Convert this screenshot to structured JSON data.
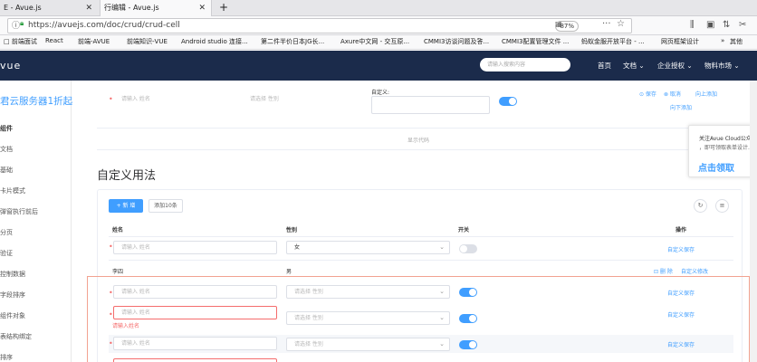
{
  "browser": {
    "tab1_title": "E - Avue.js",
    "tab2_title": "行编辑 - Avue.js",
    "url": "https://avuejs.com/doc/crud/crud-cell",
    "zoom": "87%",
    "bookmarks": [
      "□ 前端面试",
      "React",
      "前端-AVUE",
      "前端知识-VUE",
      "Android studio 连接...",
      "第二件半价日本JG长...",
      "Axure中文网 - 交互原...",
      "CMMI3访谈问题及答...",
      "CMMI3配置管理文件 ...",
      "蚂蚁金服开放平台 - ...",
      "网页框架设计",
      "其他"
    ]
  },
  "nav": {
    "logo": "vue",
    "search_placeholder": "请输入搜索内容",
    "items": [
      "首页",
      "文档 ⌄",
      "企业授权 ⌄",
      "物料市场 ⌄"
    ]
  },
  "sidebar": {
    "promo": "君云服务器1折起",
    "title": "组件",
    "items": [
      "文档",
      "基础",
      "卡片模式",
      "弹窗执行前后",
      "分页",
      "验证",
      "控制数据",
      "字段排序",
      "组件对象",
      "表结构绑定",
      "排序"
    ]
  },
  "top_section": {
    "name_placeholder": "请输入 姓名",
    "sex_placeholder": "请选择 性别",
    "custom_label": "自定义:",
    "actions": [
      "⊙ 保存",
      "⊗ 取消",
      "向上添加",
      "向下添加"
    ],
    "show_code": "显示代码"
  },
  "section_title": "自定义用法",
  "toolbar": {
    "new_button": "+ 新 增",
    "add10_button": "添加10条"
  },
  "table": {
    "headers": [
      "姓名",
      "性别",
      "开关",
      "操作"
    ],
    "rows": [
      {
        "name_placeholder": "请输入 姓名",
        "sex": "女",
        "action": "自定义保存"
      },
      {
        "name": "李四",
        "sex": "男",
        "actions": [
          "⊡ 删 除",
          "自定义修改"
        ]
      },
      {
        "name_placeholder": "请输入 姓名",
        "sex_placeholder": "请选择 性别",
        "action": "自定义保存"
      },
      {
        "name_placeholder": "请输入 姓名",
        "error": "请输入姓名",
        "sex_placeholder": "请选择 性别",
        "action": "自定义保存"
      },
      {
        "name_placeholder": "请输入 姓名",
        "sex_placeholder": "请选择 性别",
        "action": "自定义保存"
      }
    ]
  },
  "popup": {
    "line1": "关注Avue  Cloud公众",
    "line2": "，即可领取表单设计...",
    "cta": "点击领取"
  }
}
